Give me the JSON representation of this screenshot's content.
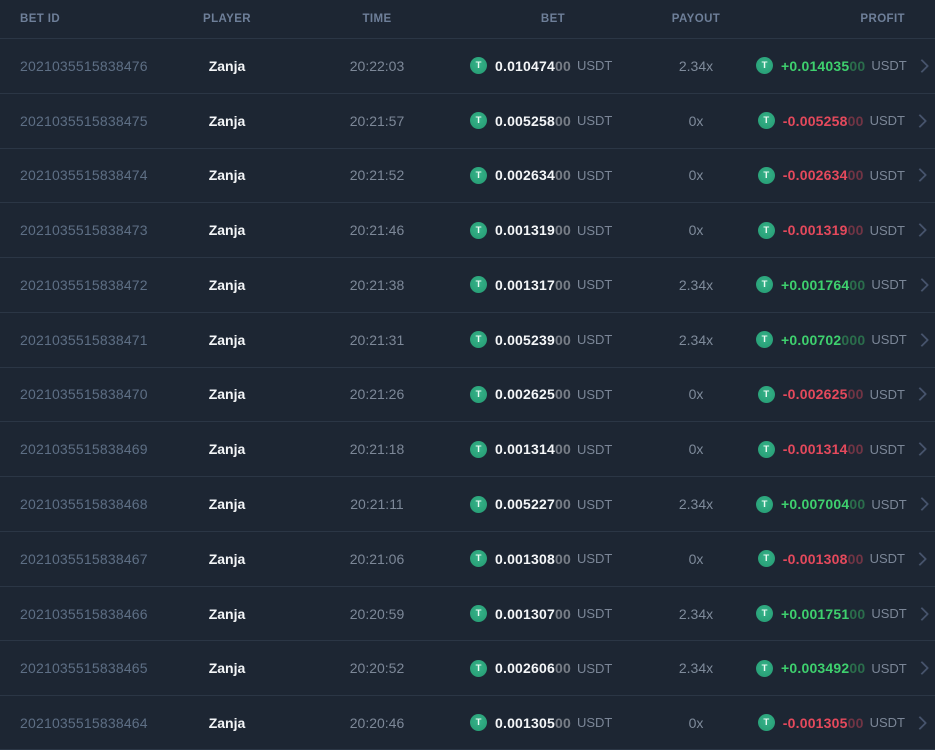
{
  "header": {
    "columns": [
      "BET ID",
      "PLAYER",
      "TIME",
      "BET",
      "PAYOUT",
      "PROFIT"
    ]
  },
  "currency_label": "USDT",
  "icons": {
    "coin": "usdt-tether-icon",
    "coin_letter": "T",
    "chevron": "chevron-right-icon"
  },
  "colors": {
    "positive": "#3ed06e",
    "negative": "#e5495c",
    "coin": "#27a17b",
    "background": "#1d2633"
  },
  "rows": [
    {
      "bet_id": "2021035515838476",
      "player": "Zanja",
      "time": "20:22:03",
      "bet": {
        "main": "0.010474",
        "dim": "00"
      },
      "payout": "2.34x",
      "profit": {
        "main": "+0.014035",
        "dim": "00",
        "sign": "positive"
      }
    },
    {
      "bet_id": "2021035515838475",
      "player": "Zanja",
      "time": "20:21:57",
      "bet": {
        "main": "0.005258",
        "dim": "00"
      },
      "payout": "0x",
      "profit": {
        "main": "-0.005258",
        "dim": "00",
        "sign": "negative"
      }
    },
    {
      "bet_id": "2021035515838474",
      "player": "Zanja",
      "time": "20:21:52",
      "bet": {
        "main": "0.002634",
        "dim": "00"
      },
      "payout": "0x",
      "profit": {
        "main": "-0.002634",
        "dim": "00",
        "sign": "negative"
      }
    },
    {
      "bet_id": "2021035515838473",
      "player": "Zanja",
      "time": "20:21:46",
      "bet": {
        "main": "0.001319",
        "dim": "00"
      },
      "payout": "0x",
      "profit": {
        "main": "-0.001319",
        "dim": "00",
        "sign": "negative"
      }
    },
    {
      "bet_id": "2021035515838472",
      "player": "Zanja",
      "time": "20:21:38",
      "bet": {
        "main": "0.001317",
        "dim": "00"
      },
      "payout": "2.34x",
      "profit": {
        "main": "+0.001764",
        "dim": "00",
        "sign": "positive"
      }
    },
    {
      "bet_id": "2021035515838471",
      "player": "Zanja",
      "time": "20:21:31",
      "bet": {
        "main": "0.005239",
        "dim": "00"
      },
      "payout": "2.34x",
      "profit": {
        "main": "+0.00702",
        "dim": "000",
        "sign": "positive"
      }
    },
    {
      "bet_id": "2021035515838470",
      "player": "Zanja",
      "time": "20:21:26",
      "bet": {
        "main": "0.002625",
        "dim": "00"
      },
      "payout": "0x",
      "profit": {
        "main": "-0.002625",
        "dim": "00",
        "sign": "negative"
      }
    },
    {
      "bet_id": "2021035515838469",
      "player": "Zanja",
      "time": "20:21:18",
      "bet": {
        "main": "0.001314",
        "dim": "00"
      },
      "payout": "0x",
      "profit": {
        "main": "-0.001314",
        "dim": "00",
        "sign": "negative"
      }
    },
    {
      "bet_id": "2021035515838468",
      "player": "Zanja",
      "time": "20:21:11",
      "bet": {
        "main": "0.005227",
        "dim": "00"
      },
      "payout": "2.34x",
      "profit": {
        "main": "+0.007004",
        "dim": "00",
        "sign": "positive"
      }
    },
    {
      "bet_id": "2021035515838467",
      "player": "Zanja",
      "time": "20:21:06",
      "bet": {
        "main": "0.001308",
        "dim": "00"
      },
      "payout": "0x",
      "profit": {
        "main": "-0.001308",
        "dim": "00",
        "sign": "negative"
      }
    },
    {
      "bet_id": "2021035515838466",
      "player": "Zanja",
      "time": "20:20:59",
      "bet": {
        "main": "0.001307",
        "dim": "00"
      },
      "payout": "2.34x",
      "profit": {
        "main": "+0.001751",
        "dim": "00",
        "sign": "positive"
      }
    },
    {
      "bet_id": "2021035515838465",
      "player": "Zanja",
      "time": "20:20:52",
      "bet": {
        "main": "0.002606",
        "dim": "00"
      },
      "payout": "2.34x",
      "profit": {
        "main": "+0.003492",
        "dim": "00",
        "sign": "positive"
      }
    },
    {
      "bet_id": "2021035515838464",
      "player": "Zanja",
      "time": "20:20:46",
      "bet": {
        "main": "0.001305",
        "dim": "00"
      },
      "payout": "0x",
      "profit": {
        "main": "-0.001305",
        "dim": "00",
        "sign": "negative"
      }
    }
  ]
}
